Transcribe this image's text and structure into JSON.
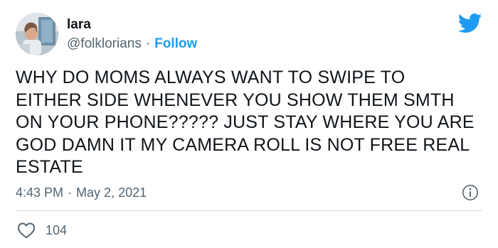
{
  "author": {
    "name": "lara",
    "handle": "@folklorians",
    "separator": "·",
    "follow_label": "Follow"
  },
  "tweet": {
    "text_lines": [
      "WHY DO MOMS ALWAYS WANT TO SWIPE TO",
      "EITHER SIDE WHENEVER YOU SHOW THEM SMTH",
      "ON YOUR PHONE????? JUST STAY WHERE YOU ARE",
      "GOD DAMN IT MY CAMERA ROLL IS NOT FREE REAL",
      "ESTATE"
    ],
    "time": "4:43 PM",
    "separator": "·",
    "date": "May 2, 2021"
  },
  "engagement": {
    "likes": "104"
  },
  "icons": {
    "brand": "twitter-bird-icon",
    "info": "info-icon",
    "like": "heart-icon"
  },
  "colors": {
    "brand_blue": "#1d9bf0",
    "text_primary": "#0f1419",
    "text_secondary": "#536471",
    "divider": "#cfd9de"
  }
}
